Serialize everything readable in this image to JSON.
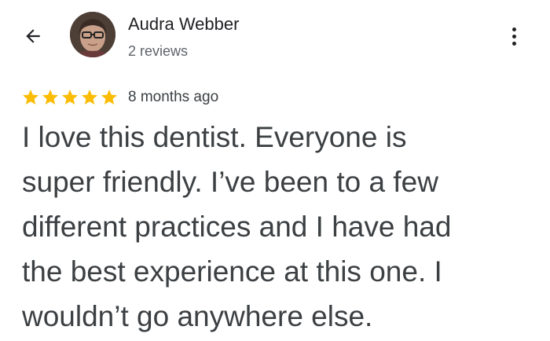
{
  "header": {
    "back_icon": "arrow-back-icon",
    "menu_icon": "more-vert-icon"
  },
  "author": {
    "name": "Audra Webber",
    "reviews": "2 reviews"
  },
  "review": {
    "rating": 5,
    "rating_max": 5,
    "star_color": "#fbbc04",
    "time_ago": "8 months ago",
    "text": "I love this dentist.  Everyone is\nsuper friendly.  I’ve been to a few\ndifferent practices and I have had\nthe best experience at this one.  I\nwouldn’t go anywhere else."
  }
}
